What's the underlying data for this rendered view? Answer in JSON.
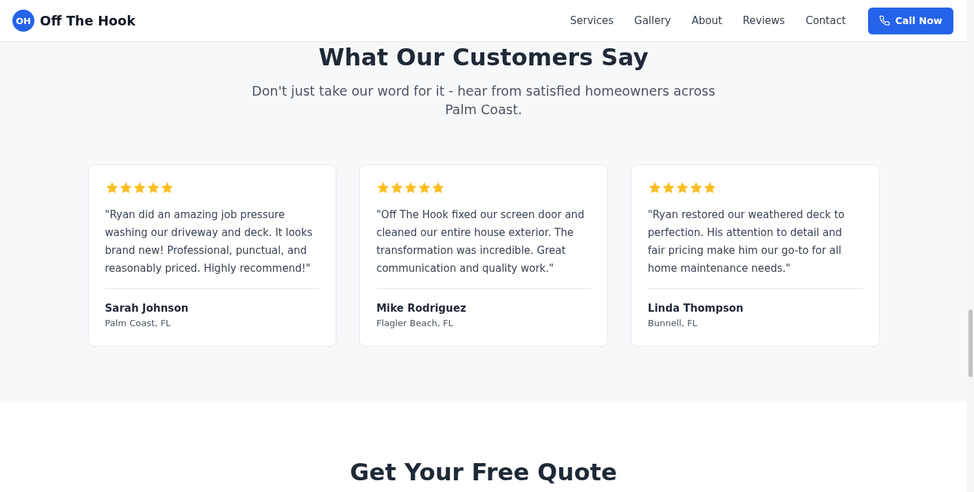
{
  "header": {
    "logo_mark": "OH",
    "brand": "Off The Hook",
    "nav": [
      {
        "label": "Services"
      },
      {
        "label": "Gallery"
      },
      {
        "label": "About"
      },
      {
        "label": "Reviews"
      },
      {
        "label": "Contact"
      }
    ],
    "cta": "Call Now"
  },
  "testimonials": {
    "title": "What Our Customers Say",
    "subtitle": "Don't just take our word for it - hear from satisfied homeowners across Palm Coast.",
    "reviews": [
      {
        "stars": 5,
        "quote": "\"Ryan did an amazing job pressure washing our driveway and deck. It looks brand new! Professional, punctual, and reasonably priced. Highly recommend!\"",
        "name": "Sarah Johnson",
        "location": "Palm Coast, FL"
      },
      {
        "stars": 5,
        "quote": "\"Off The Hook fixed our screen door and cleaned our entire house exterior. The transformation was incredible. Great communication and quality work.\"",
        "name": "Mike Rodriguez",
        "location": "Flagler Beach, FL"
      },
      {
        "stars": 5,
        "quote": "\"Ryan restored our weathered deck to perfection. His attention to detail and fair pricing make him our go-to for all home maintenance needs.\"",
        "name": "Linda Thompson",
        "location": "Bunnell, FL"
      }
    ]
  },
  "quote_section": {
    "title": "Get Your Free Quote"
  }
}
